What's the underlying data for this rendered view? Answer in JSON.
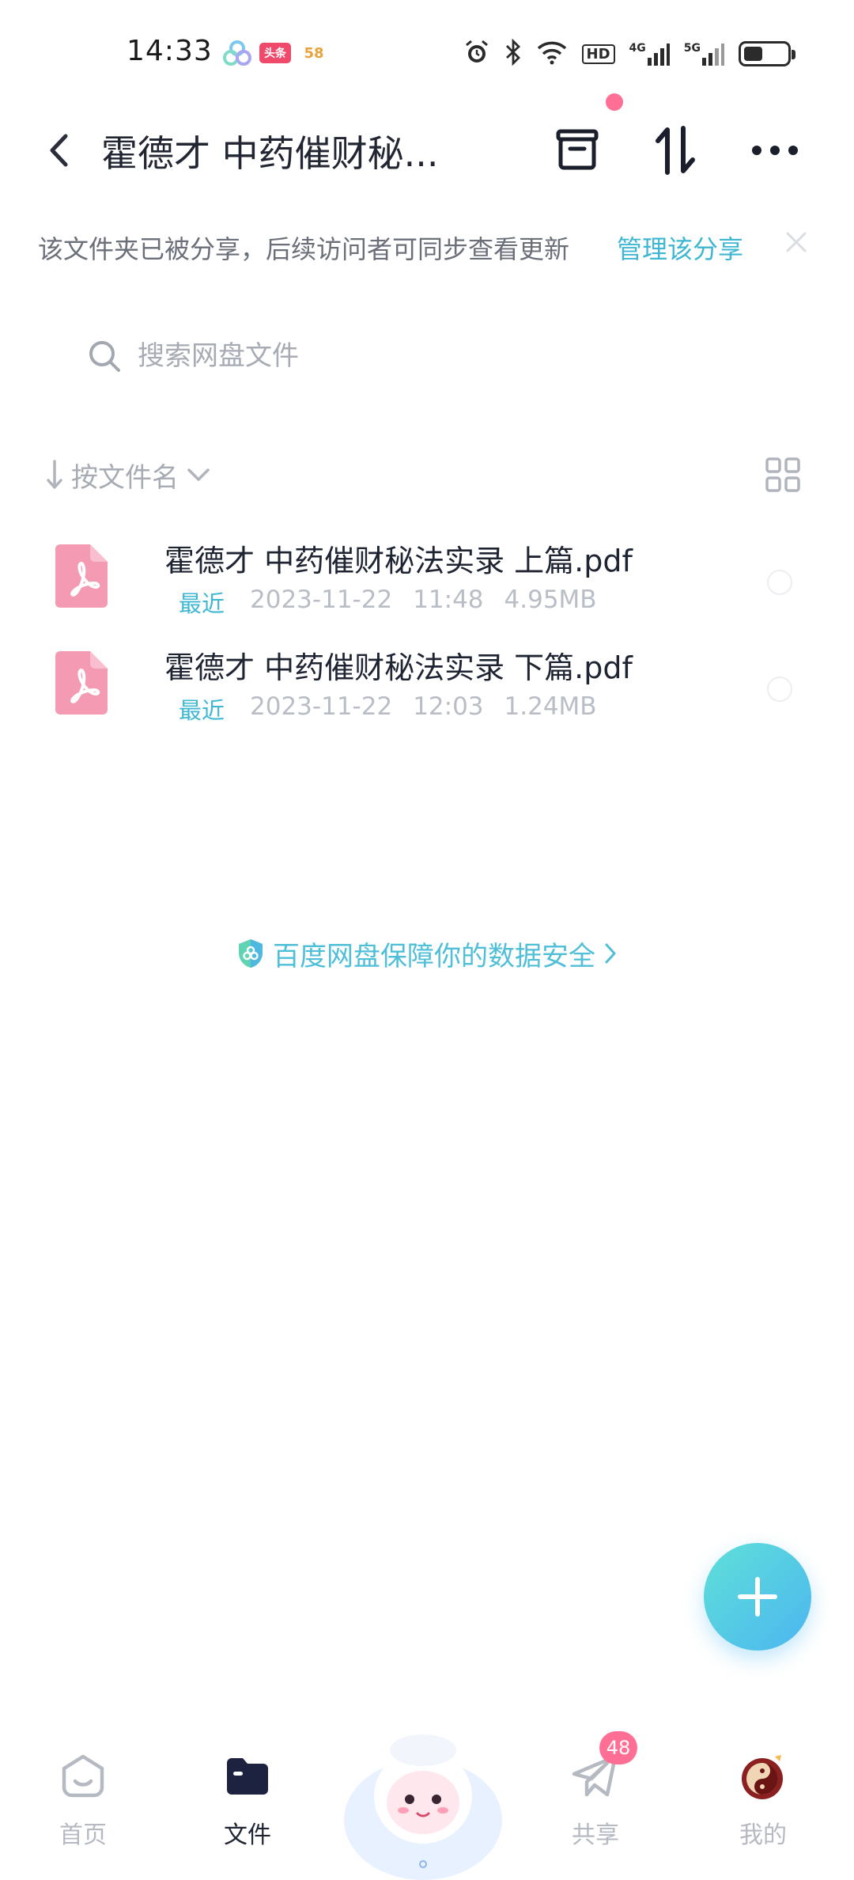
{
  "status_bar": {
    "time": "14:33",
    "app_badge_toutiao": "头条",
    "app_badge_58": "58",
    "signal_4g": "4G",
    "signal_5g": "5G",
    "hd_label": "HD",
    "battery_level": 0.45
  },
  "header": {
    "title": "霍德才 中药催财秘...",
    "has_new_dot": true
  },
  "share_notice": {
    "text": "该文件夹已被分享，后续访问者可同步查看更新",
    "link": "管理该分享"
  },
  "search": {
    "placeholder": "搜索网盘文件"
  },
  "sort": {
    "label": "按文件名"
  },
  "files": [
    {
      "name": "霍德才 中药催财秘法实录 上篇.pdf",
      "tag": "最近",
      "date": "2023-11-22",
      "time": "11:48",
      "size": "4.95MB"
    },
    {
      "name": "霍德才 中药催财秘法实录 下篇.pdf",
      "tag": "最近",
      "date": "2023-11-22",
      "time": "12:03",
      "size": "1.24MB"
    }
  ],
  "security": {
    "text": "百度网盘保障你的数据安全"
  },
  "bottom_nav": {
    "home": "首页",
    "files": "文件",
    "share": "共享",
    "share_badge": "48",
    "mine": "我的"
  },
  "colors": {
    "accent": "#3fb7d3",
    "pdf_pink": "#f59ab3",
    "badge": "#ff6f95",
    "fab_start": "#5fe0d9",
    "fab_end": "#4cb6f0"
  }
}
